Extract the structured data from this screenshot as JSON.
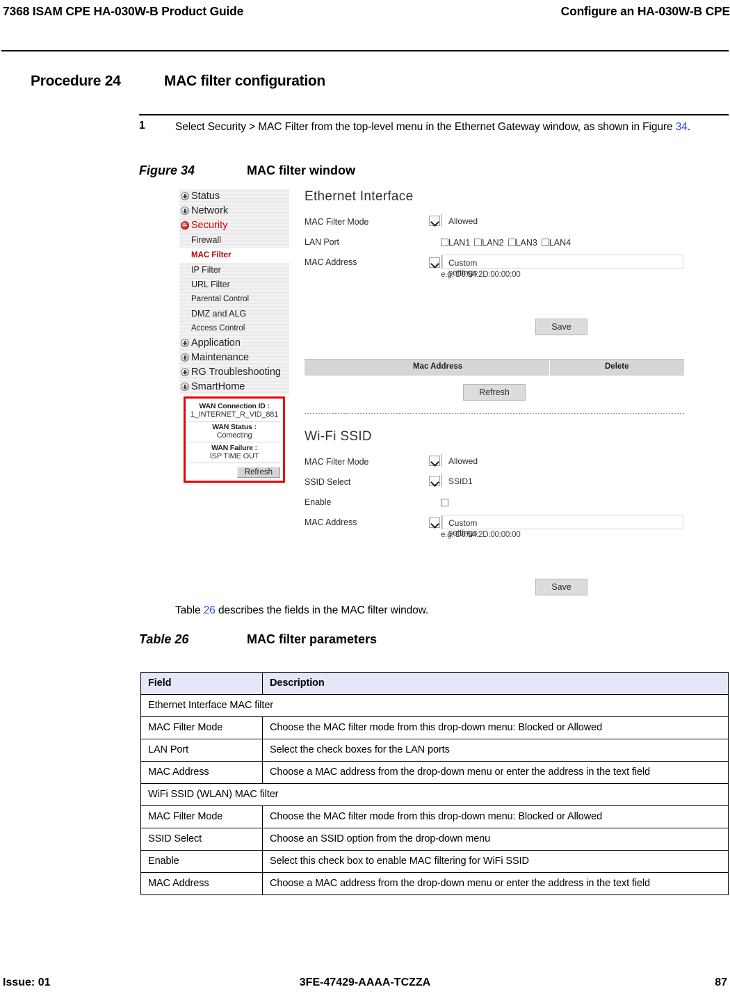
{
  "header": {
    "left": "7368 ISAM CPE HA-030W-B Product Guide",
    "right": "Configure an HA-030W-B CPE"
  },
  "procedure": {
    "label": "Procedure 24",
    "title": "MAC filter configuration",
    "step_number": "1",
    "step_text_before": "Select Security > MAC Filter from the top-level menu in the Ethernet Gateway window, as shown in Figure ",
    "step_xref": "34",
    "step_text_after": "."
  },
  "figure": {
    "label": "Figure 34",
    "title": "MAC filter window",
    "nav": {
      "items": [
        {
          "label": "Status",
          "icon": "plus-icon",
          "level": "top"
        },
        {
          "label": "Network",
          "icon": "plus-icon",
          "level": "top"
        },
        {
          "label": "Security",
          "icon": "minus-icon",
          "level": "top",
          "color": "#cc0000"
        },
        {
          "label": "Firewall",
          "icon": "none",
          "level": "sub"
        },
        {
          "label": "MAC Filter",
          "icon": "none",
          "level": "sub",
          "selected": true
        },
        {
          "label": "IP Filter",
          "icon": "none",
          "level": "sub"
        },
        {
          "label": "URL Filter",
          "icon": "none",
          "level": "sub"
        },
        {
          "label": "Parental Control",
          "icon": "none",
          "level": "sub-small"
        },
        {
          "label": "DMZ and ALG",
          "icon": "none",
          "level": "sub"
        },
        {
          "label": "Access Control",
          "icon": "none",
          "level": "sub-small"
        },
        {
          "label": "Application",
          "icon": "plus-icon",
          "level": "top"
        },
        {
          "label": "Maintenance",
          "icon": "plus-icon",
          "level": "top"
        },
        {
          "label": "RG Troubleshooting",
          "icon": "plus-icon",
          "level": "top"
        },
        {
          "label": "SmartHome",
          "icon": "plus-icon",
          "level": "top"
        }
      ]
    },
    "wan_box": {
      "connection_id_label": "WAN Connection ID :",
      "connection_id_value": "1_INTERNET_R_VID_881",
      "status_label": "WAN Status :",
      "status_value": "Comecting",
      "failure_label": "WAN Failure :",
      "failure_value": "ISP TIME OUT",
      "refresh_label": "Refresh"
    },
    "ethernet": {
      "section_title": "Ethernet Interface",
      "mac_filter_mode_label": "MAC Filter Mode",
      "mac_filter_mode_value": "Allowed",
      "lan_port_label": "LAN Port",
      "lan_ports": [
        "LAN1",
        "LAN2",
        "LAN3",
        "LAN4"
      ],
      "mac_address_label": "MAC Address",
      "mac_address_value": "Custom settings",
      "mac_address_input": "",
      "hint": "e.g: D0:54:2D:00:00:00",
      "save_label": "Save"
    },
    "mac_table": {
      "col_address": "Mac Address",
      "col_delete": "Delete",
      "refresh_label": "Refresh"
    },
    "wifi": {
      "section_title": "Wi-Fi SSID",
      "mac_filter_mode_label": "MAC Filter Mode",
      "mac_filter_mode_value": "Allowed",
      "ssid_select_label": "SSID Select",
      "ssid_select_value": "SSID1",
      "enable_label": "Enable",
      "mac_address_label": "MAC Address",
      "mac_address_value": "Custom settings",
      "mac_address_input": "",
      "hint": "e.g: D0:54:2D:00:00:00",
      "save_label": "Save"
    }
  },
  "table_lead": {
    "before": "Table ",
    "xref": "26",
    "after": " describes the fields in the MAC filter window."
  },
  "table": {
    "label": "Table 26",
    "title": "MAC filter parameters",
    "headers": [
      "Field",
      "Description"
    ],
    "rows": [
      {
        "type": "section",
        "field": "Ethernet Interface MAC filter"
      },
      {
        "type": "data",
        "field": "MAC Filter Mode",
        "description": "Choose the MAC filter mode from this drop-down menu: Blocked or Allowed"
      },
      {
        "type": "data",
        "field": "LAN Port",
        "description": "Select the check boxes for the LAN ports"
      },
      {
        "type": "data",
        "field": "MAC Address",
        "description": "Choose a MAC address from the drop-down menu or enter the address in the text field"
      },
      {
        "type": "section",
        "field": "WiFi SSID (WLAN) MAC filter"
      },
      {
        "type": "data",
        "field": "MAC Filter Mode",
        "description": "Choose the MAC filter mode from this drop-down menu: Blocked or Allowed"
      },
      {
        "type": "data",
        "field": "SSID Select",
        "description": "Choose an SSID option from the drop-down menu"
      },
      {
        "type": "data",
        "field": "Enable",
        "description": "Select this check box to enable MAC filtering for WiFi SSID"
      },
      {
        "type": "data",
        "field": "MAC Address",
        "description": "Choose a MAC address from the drop-down menu or enter the address in the text field"
      }
    ]
  },
  "footer": {
    "issue": "Issue: 01",
    "doc_id": "3FE-47429-AAAA-TCZZA",
    "page": "87"
  }
}
